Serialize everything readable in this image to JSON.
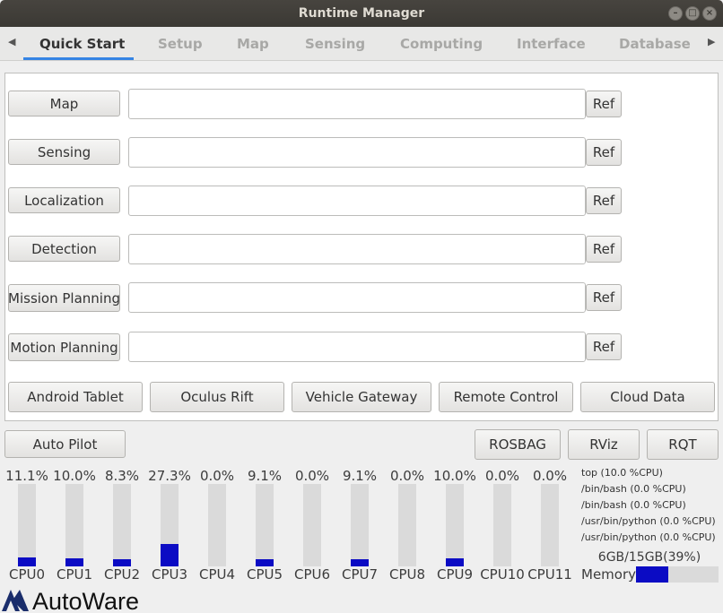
{
  "window": {
    "title": "Runtime Manager"
  },
  "tabs": [
    "Quick Start",
    "Setup",
    "Map",
    "Sensing",
    "Computing",
    "Interface",
    "Database"
  ],
  "quick_start": {
    "rows": [
      {
        "label": "Map",
        "value": "",
        "ref": "Ref"
      },
      {
        "label": "Sensing",
        "value": "",
        "ref": "Ref"
      },
      {
        "label": "Localization",
        "value": "",
        "ref": "Ref"
      },
      {
        "label": "Detection",
        "value": "",
        "ref": "Ref"
      },
      {
        "label": "Mission Planning",
        "value": "",
        "ref": "Ref"
      },
      {
        "label": "Motion Planning",
        "value": "",
        "ref": "Ref"
      }
    ],
    "device_buttons": [
      "Android Tablet",
      "Oculus Rift",
      "Vehicle Gateway",
      "Remote Control",
      "Cloud Data"
    ]
  },
  "bottom_buttons": {
    "auto_pilot": "Auto Pilot",
    "rosbag": "ROSBAG",
    "rviz": "RViz",
    "rqt": "RQT"
  },
  "cpus": [
    {
      "label": "CPU0",
      "percent_text": "11.1%",
      "value": 11.1
    },
    {
      "label": "CPU1",
      "percent_text": "10.0%",
      "value": 10.0
    },
    {
      "label": "CPU2",
      "percent_text": "8.3%",
      "value": 8.3
    },
    {
      "label": "CPU3",
      "percent_text": "27.3%",
      "value": 27.3
    },
    {
      "label": "CPU4",
      "percent_text": "0.0%",
      "value": 0.0
    },
    {
      "label": "CPU5",
      "percent_text": "9.1%",
      "value": 9.1
    },
    {
      "label": "CPU6",
      "percent_text": "0.0%",
      "value": 0.0
    },
    {
      "label": "CPU7",
      "percent_text": "9.1%",
      "value": 9.1
    },
    {
      "label": "CPU8",
      "percent_text": "0.0%",
      "value": 0.0
    },
    {
      "label": "CPU9",
      "percent_text": "10.0%",
      "value": 10.0
    },
    {
      "label": "CPU10",
      "percent_text": "0.0%",
      "value": 0.0
    },
    {
      "label": "CPU11",
      "percent_text": "0.0%",
      "value": 0.0
    }
  ],
  "processes": [
    "top (10.0 %CPU)",
    "/bin/bash (0.0 %CPU)",
    "/bin/bash (0.0 %CPU)",
    "/usr/bin/python (0.0 %CPU)",
    "/usr/bin/python (0.0 %CPU)"
  ],
  "memory": {
    "text": "6GB/15GB(39%)",
    "label": "Memory",
    "percent": 39
  },
  "logo": {
    "text": "AutoWare"
  },
  "colors": {
    "accent": "#3584e4",
    "usage_bar": "#0b0bc4",
    "titlebar": "#3b3934"
  }
}
